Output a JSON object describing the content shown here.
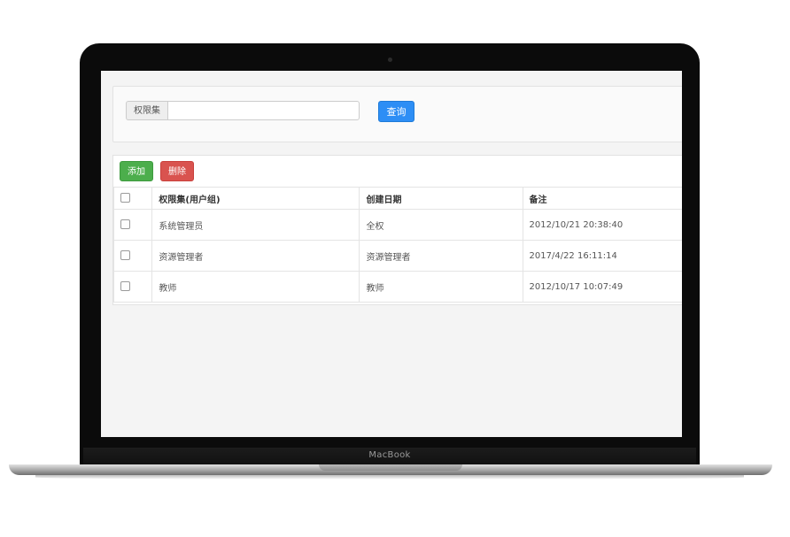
{
  "device": {
    "brand": "MacBook"
  },
  "search": {
    "field_label": "权限集",
    "value": "",
    "placeholder": "",
    "query_button": "查询"
  },
  "toolbar": {
    "add_label": "添加",
    "delete_label": "删除"
  },
  "table": {
    "headers": [
      "权限集(用户组)",
      "创建日期",
      "备注"
    ],
    "rows": [
      {
        "name": "系统管理员",
        "created": "全权",
        "note": "2012/10/21 20:38:40"
      },
      {
        "name": "资源管理者",
        "created": "资源管理者",
        "note": "2017/4/22 16:11:14"
      },
      {
        "name": "教师",
        "created": "教师",
        "note": "2012/10/17 10:07:49"
      }
    ]
  },
  "colors": {
    "primary": "#2d8ef5",
    "success": "#4cae4c",
    "danger": "#d9534f"
  }
}
